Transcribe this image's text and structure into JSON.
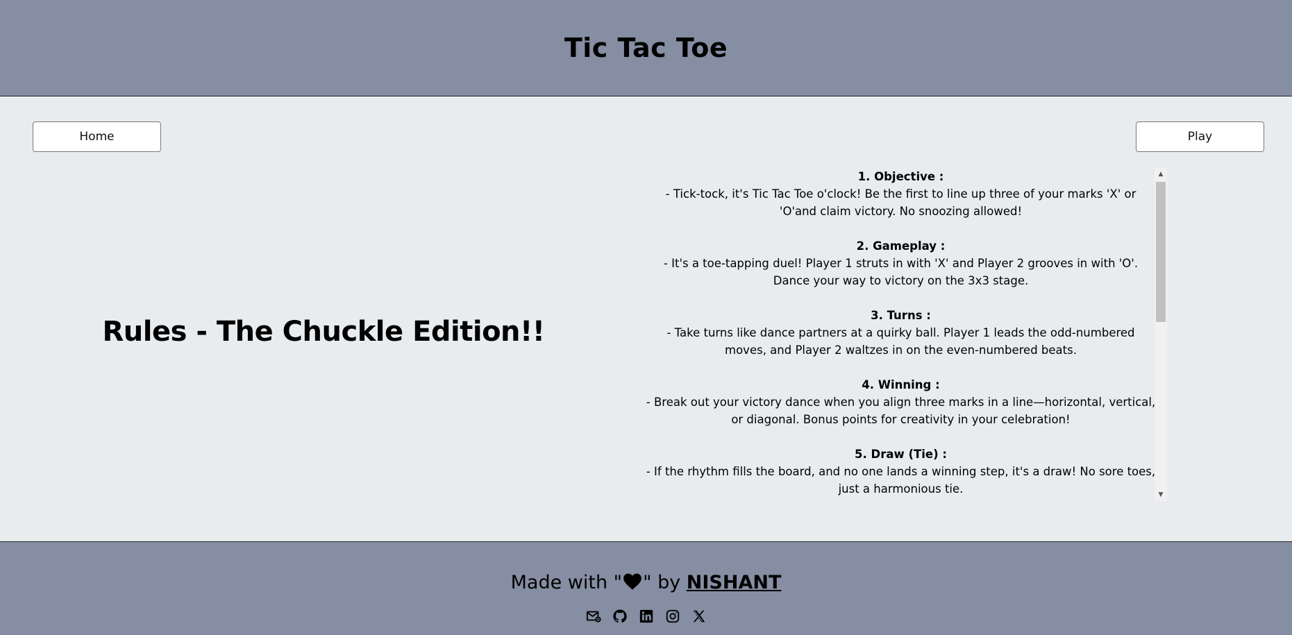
{
  "header": {
    "title": "Tic Tac Toe"
  },
  "nav": {
    "home_label": "Home",
    "play_label": "Play"
  },
  "main": {
    "heading": "Rules - The Chuckle Edition!!"
  },
  "rules": [
    {
      "title": "1. Objective :",
      "text": "- Tick-tock, it's Tic Tac Toe o'clock! Be the first to line up three of your marks 'X' or 'O'and claim victory. No snoozing allowed!"
    },
    {
      "title": "2. Gameplay :",
      "text": "- It's a toe-tapping duel! Player 1 struts in with 'X' and Player 2 grooves in with 'O'. Dance your way to victory on the 3x3 stage."
    },
    {
      "title": "3. Turns :",
      "text": "- Take turns like dance partners at a quirky ball. Player 1 leads the odd-numbered moves, and Player 2 waltzes in on the even-numbered beats."
    },
    {
      "title": "4. Winning :",
      "text": "- Break out your victory dance when you align three marks in a line—horizontal, vertical, or diagonal. Bonus points for creativity in your celebration!"
    },
    {
      "title": "5. Draw (Tie) :",
      "text": "- If the rhythm fills the board, and no one lands a winning step, it's a draw! No sore toes, just a harmonious tie."
    }
  ],
  "footer": {
    "made_with_prefix": "Made with \"",
    "made_with_suffix": "\" by ",
    "author": "NISHANT",
    "heart_icon": "heart-icon",
    "social_icons": [
      "email-icon",
      "github-icon",
      "linkedin-icon",
      "instagram-icon",
      "x-icon"
    ]
  }
}
